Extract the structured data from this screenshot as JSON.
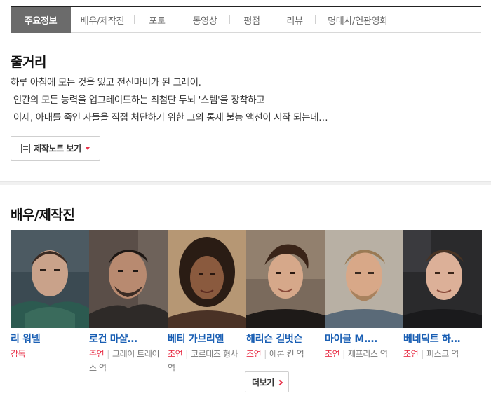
{
  "tabs": [
    {
      "label": "주요정보",
      "active": true
    },
    {
      "label": "배우/제작진",
      "active": false
    },
    {
      "label": "포토",
      "active": false
    },
    {
      "label": "동영상",
      "active": false
    },
    {
      "label": "평점",
      "active": false
    },
    {
      "label": "리뷰",
      "active": false
    },
    {
      "label": "명대사/연관영화",
      "active": false
    }
  ],
  "synopsis": {
    "title": "줄거리",
    "lines": [
      "하루 아침에 모든 것을 잃고 전신마비가 된 그레이.",
      " 인간의 모든 능력을 업그레이드하는 최첨단 두뇌 '스템'을 장착하고",
      " 이제, 아내를 죽인 자들을 직접 처단하기 위한 그의 통제 불능 액션이 시작 되는데…"
    ],
    "note_button": "제작노트 보기"
  },
  "cast": {
    "title": "배우/제작진",
    "items": [
      {
        "name": "리 워넬",
        "role": "감독",
        "character": ""
      },
      {
        "name": "로건 마샬…",
        "role": "주연",
        "character": "그레이 트레이스 역"
      },
      {
        "name": "베티 가브리엘",
        "role": "조연",
        "character": "코르테즈 형사 역"
      },
      {
        "name": "해리슨 길벗슨",
        "role": "조연",
        "character": "에론 킨 역"
      },
      {
        "name": "마이클 M.…",
        "role": "조연",
        "character": "제프리스 역"
      },
      {
        "name": "베네딕트 하…",
        "role": "조연",
        "character": "피스크 역"
      }
    ],
    "more_button": "더보기"
  },
  "colors": {
    "accent_red": "#e8334a",
    "link_blue": "#1a5fb4",
    "active_tab_bg": "#6b6b6b"
  }
}
